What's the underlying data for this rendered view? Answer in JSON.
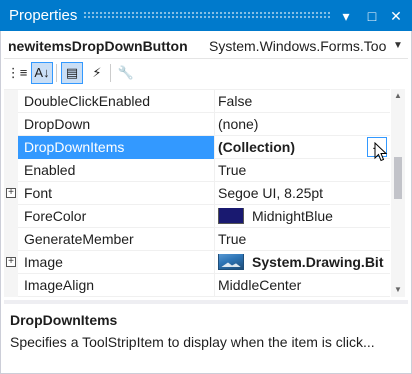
{
  "window": {
    "title": "Properties",
    "buttons": {
      "dropdown": "▾",
      "maximize": "□",
      "close": "✕"
    }
  },
  "object_selector": {
    "name": "newitemsDropDownButton",
    "type": "System.Windows.Forms.Too",
    "dropdown_icon": "chevron-down-icon"
  },
  "toolbar": {
    "items": [
      {
        "name": "categorized-icon",
        "glyph": "⋮≡",
        "active": false
      },
      {
        "name": "alphabetical-icon",
        "glyph": "A↓",
        "active": true
      },
      {
        "name": "properties-icon",
        "glyph": "▤",
        "active": true
      },
      {
        "name": "events-icon",
        "glyph": "⚡",
        "active": false
      },
      {
        "name": "property-pages-icon",
        "glyph": "🔧",
        "active": false
      }
    ]
  },
  "grid": {
    "rows": [
      {
        "name": "DoubleClickEnabled",
        "value": "False"
      },
      {
        "name": "DropDown",
        "value": "(none)"
      },
      {
        "name": "DropDownItems",
        "value": "(Collection)",
        "selected": true,
        "bold": true,
        "ellipsis": "..."
      },
      {
        "name": "Enabled",
        "value": "True"
      },
      {
        "name": "Font",
        "value": "Segoe UI, 8.25pt",
        "expandable": true
      },
      {
        "name": "ForeColor",
        "value": "MidnightBlue",
        "swatch": "#191970"
      },
      {
        "name": "GenerateMember",
        "value": "True"
      },
      {
        "name": "Image",
        "value": "System.Drawing.Bit",
        "expandable": true,
        "bold": true,
        "image": true
      },
      {
        "name": "ImageAlign",
        "value": "MiddleCenter"
      }
    ]
  },
  "description": {
    "title": "DropDownItems",
    "text": "Specifies a ToolStripItem to display when the item is click..."
  },
  "colors": {
    "title_bar": "#007acc",
    "selection": "#3399ff",
    "fore_color_swatch": "#191970"
  }
}
